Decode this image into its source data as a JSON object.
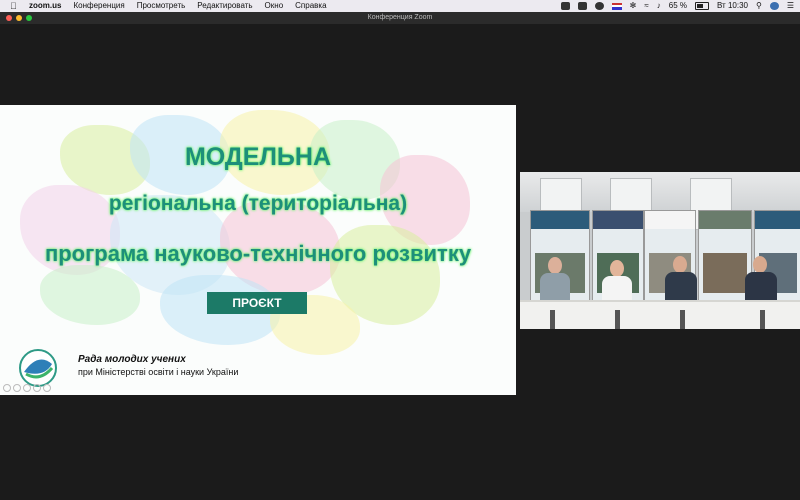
{
  "menubar": {
    "app_name": "zoom.us",
    "menus": [
      "Конференция",
      "Просмотреть",
      "Редактировать",
      "Окно",
      "Справка"
    ],
    "battery_percent": "65 %",
    "clock": "Вт 10:30",
    "icons": [
      "apple-icon",
      "video-icon",
      "tray-icon",
      "history-icon",
      "flag-icon",
      "bluetooth-icon",
      "wifi-icon",
      "volume-icon",
      "battery-icon",
      "search-icon",
      "avatar-icon",
      "menu-list-icon"
    ]
  },
  "window": {
    "title": "Конференция Zoom"
  },
  "slide": {
    "line1": "МОДЕЛЬНА",
    "line2": "регіональна (територіальна)",
    "line3": "програма науково-технічного розвитку",
    "button": "ПРОЄКТ",
    "council_name": "Рада молодих учених",
    "council_sub": "при Міністерстві освіти і науки України",
    "map_colors": [
      "#f6c3d6",
      "#d8ef9f",
      "#bfe3f5",
      "#f8f2a8",
      "#c9f0c8",
      "#f3d1ea",
      "#cde8f6"
    ]
  },
  "video": {
    "participants": 4,
    "banner_colors": [
      "#2c5b7a",
      "#6a7c6c",
      "#3a4f6f"
    ]
  }
}
